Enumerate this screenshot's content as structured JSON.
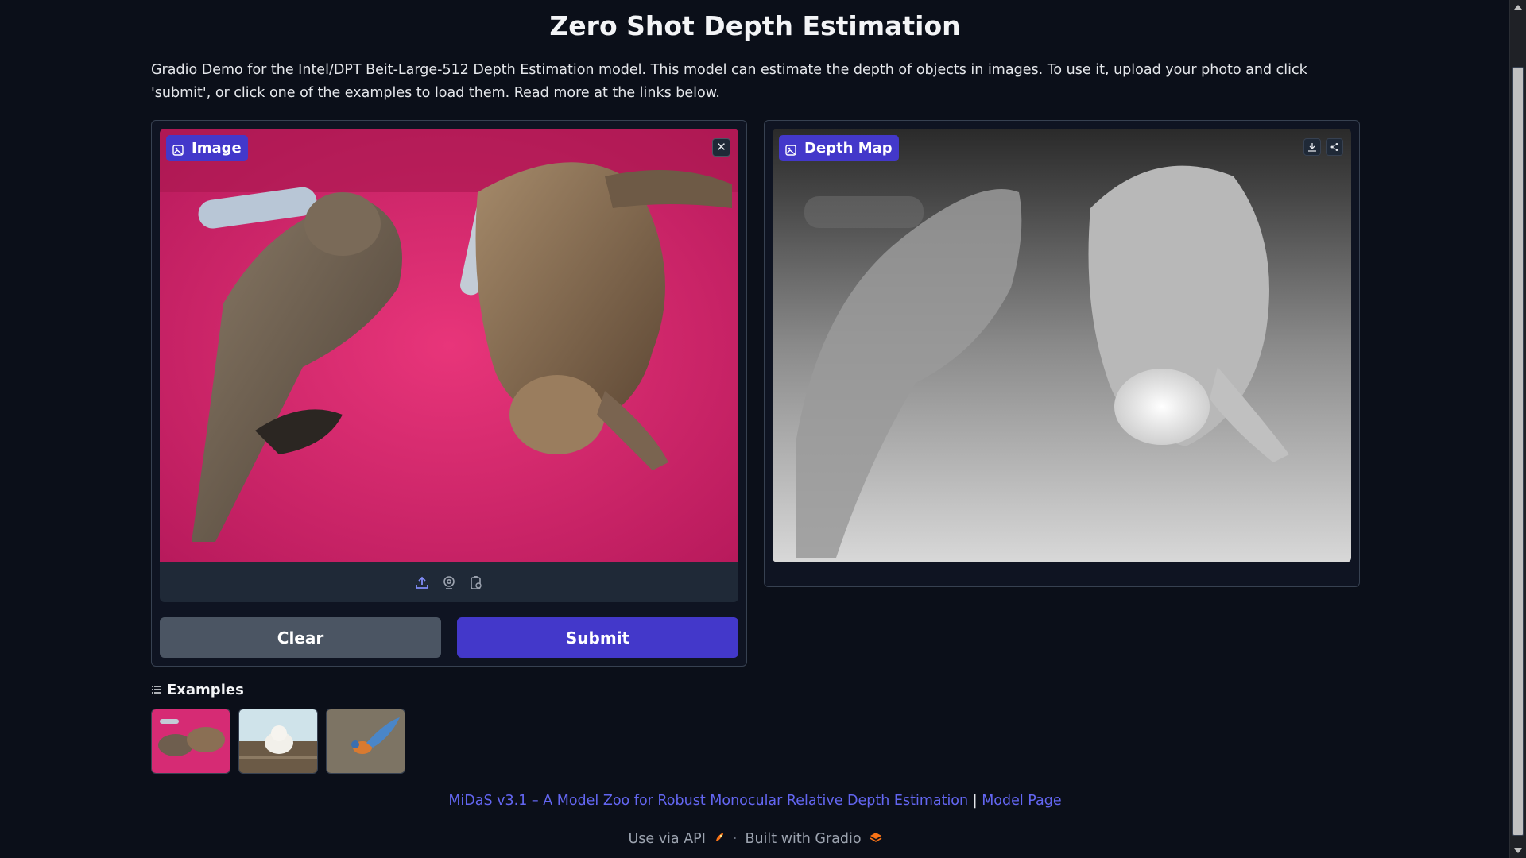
{
  "header": {
    "title": "Zero Shot Depth Estimation",
    "description": "Gradio Demo for the Intel/DPT Beit-Large-512 Depth Estimation model. This model can estimate the depth of objects in images. To use it, upload your photo and click 'submit', or click one of the examples to load them. Read more at the links below."
  },
  "input_panel": {
    "label": "Image",
    "close_icon": "close-icon",
    "image_subject": "two tabby cats sleeping on pink blanket with remote controls",
    "toolbar_icons": [
      "upload-icon",
      "webcam-icon",
      "clipboard-icon"
    ],
    "clear_label": "Clear",
    "submit_label": "Submit"
  },
  "output_panel": {
    "label": "Depth Map",
    "action_icons": [
      "download-icon",
      "share-icon"
    ]
  },
  "examples": {
    "label": "Examples",
    "items": [
      {
        "name": "cats"
      },
      {
        "name": "puppy"
      },
      {
        "name": "bird"
      }
    ]
  },
  "links": {
    "paper": "MiDaS v3.1 – A Model Zoo for Robust Monocular Relative Depth Estimation",
    "separator": "|",
    "model_page": "Model Page"
  },
  "footer": {
    "api": "Use via API",
    "separator": "·",
    "built": "Built with Gradio"
  },
  "colors": {
    "background": "#0b0f19",
    "accent": "#4338ca",
    "clear_button": "#4b5563",
    "link": "#6366f1"
  }
}
